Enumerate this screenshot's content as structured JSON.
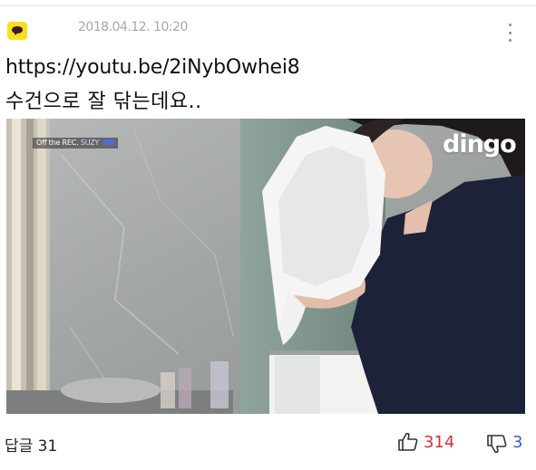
{
  "post": {
    "timestamp": "2018.04.12. 10:20",
    "link": "https://youtu.be/2iNybOwhei8",
    "text": "수건으로 잘 닦는데요.."
  },
  "video": {
    "tag_prefix": "Off the REC.",
    "tag_name": "SUZY",
    "logo": "dingo"
  },
  "footer": {
    "reply_label": "답글 31",
    "like_count": "314",
    "dislike_count": "3"
  },
  "colors": {
    "badge_yellow": "#f7df1e",
    "like_red": "#d1323a",
    "dislike_blue": "#3a5fc7",
    "timestamp_gray": "#a8a8a8"
  },
  "icons": {
    "header_badge": "talk-bubble-icon",
    "menu": "more-vertical-icon",
    "like": "thumbs-up-icon",
    "dislike": "thumbs-down-icon"
  }
}
